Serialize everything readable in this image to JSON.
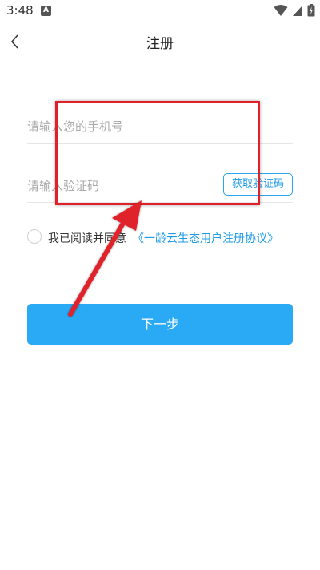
{
  "status_bar": {
    "time": "3:48",
    "app_icon": "A"
  },
  "nav": {
    "title": "注册",
    "back_icon": "chevron-left-icon"
  },
  "form": {
    "phone_placeholder": "请输入您的手机号",
    "code_placeholder": "请输入验证码",
    "get_code_label": "获取验证码",
    "agree_text": "我已阅读并同意",
    "agreement_link": "《一龄云生态用户注册协议》",
    "next_label": "下一步"
  },
  "colors": {
    "accent": "#2aaaf5",
    "link": "#1e9be6",
    "annotation": "#e0202a"
  }
}
